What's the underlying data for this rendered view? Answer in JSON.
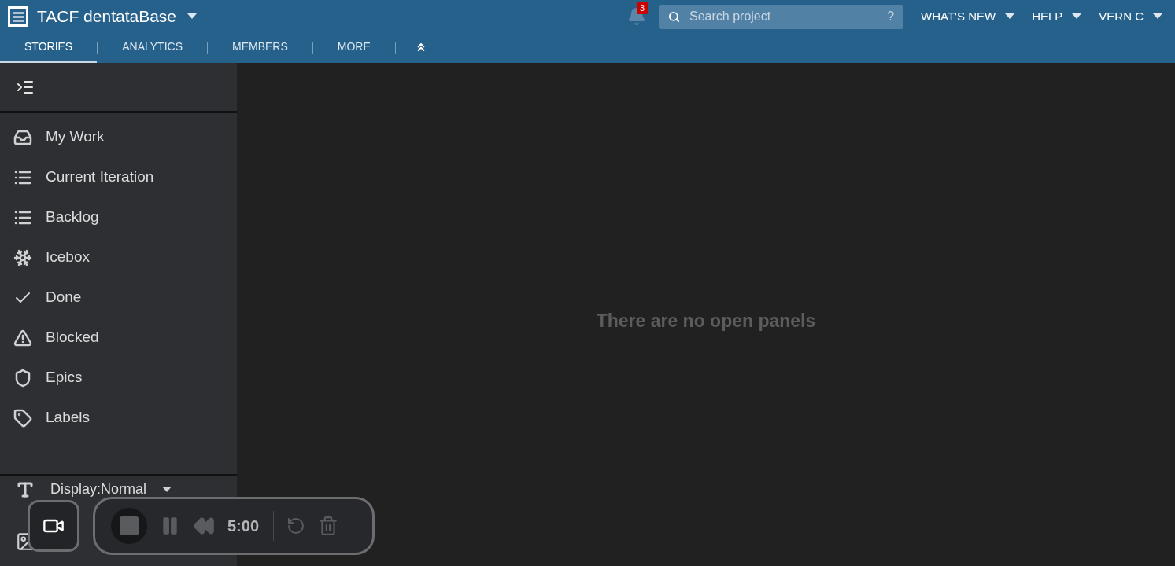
{
  "header": {
    "project_title": "TACF dentataBase",
    "notifications": {
      "count": "3"
    },
    "search": {
      "placeholder": "Search project",
      "help": "?"
    },
    "menus": [
      "WHAT'S NEW",
      "HELP",
      "VERN C"
    ]
  },
  "tabs": [
    {
      "label": "STORIES",
      "selected": true
    },
    {
      "label": "ANALYTICS",
      "selected": false
    },
    {
      "label": "MEMBERS",
      "selected": false
    },
    {
      "label": "MORE",
      "selected": false
    }
  ],
  "sidebar": {
    "items": [
      {
        "label": "My Work",
        "kind": "inbox"
      },
      {
        "label": "Current Iteration",
        "kind": "list"
      },
      {
        "label": "Backlog",
        "kind": "list"
      },
      {
        "label": "Icebox",
        "kind": "snowflake"
      },
      {
        "label": "Done",
        "kind": "check"
      },
      {
        "label": "Blocked",
        "kind": "warning"
      },
      {
        "label": "Epics",
        "kind": "shield"
      },
      {
        "label": "Labels",
        "kind": "tag"
      }
    ],
    "display": "Display:Normal"
  },
  "main": {
    "empty_message": "There are no open panels"
  },
  "recorder": {
    "time": "5:00"
  }
}
